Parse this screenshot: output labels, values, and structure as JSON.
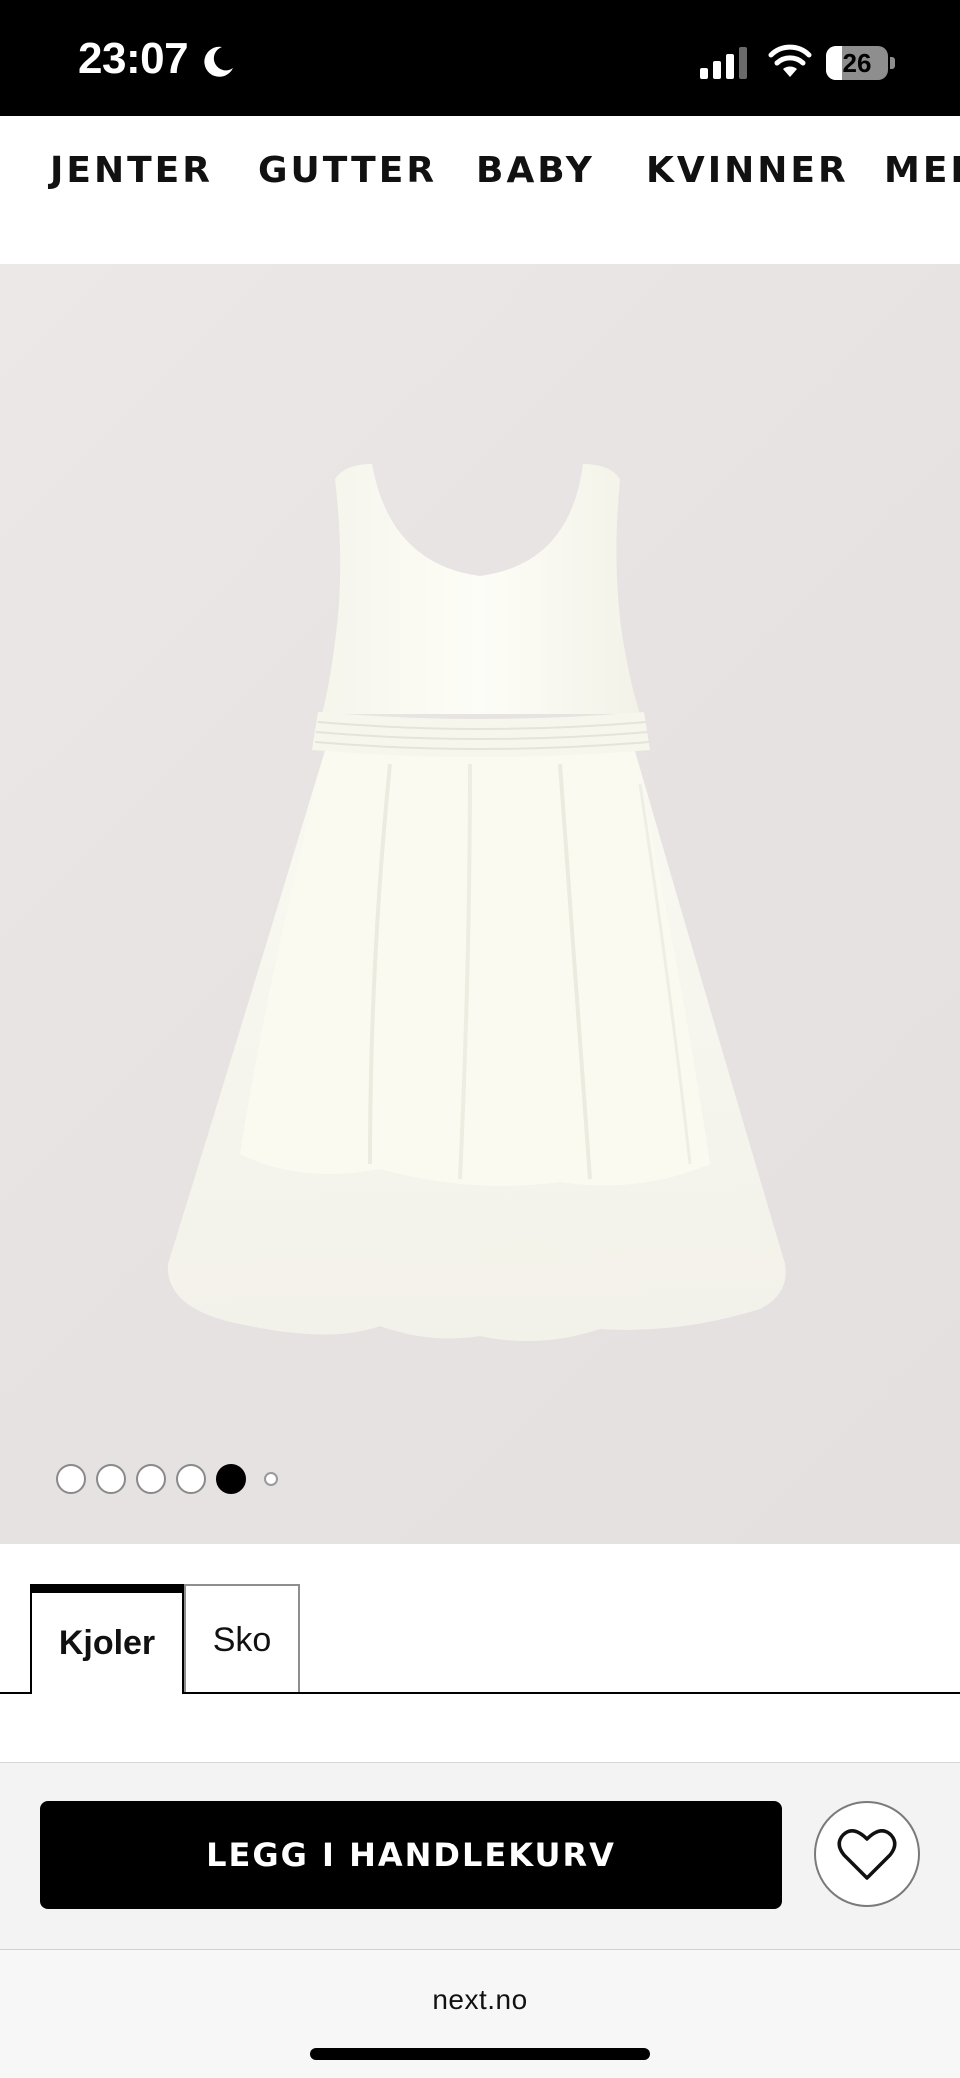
{
  "status_bar": {
    "time": "23:07",
    "battery": "26",
    "battery_level": 0.26,
    "icons": [
      "moon-icon",
      "signal-icon",
      "wifi-icon",
      "battery-icon"
    ]
  },
  "category_nav": {
    "items": [
      "JENTER",
      "GUTTER",
      "BABY",
      "KVINNER",
      "MEN"
    ]
  },
  "product_image": {
    "carousel": {
      "count": 6,
      "active_index": 4
    }
  },
  "tabs": {
    "items": [
      "Kjoler",
      "Sko"
    ],
    "active": "Kjoler"
  },
  "cart_bar": {
    "add_to_cart_label": "LEGG I HANDLEKURV",
    "wishlist_icon": "heart-icon"
  },
  "browser": {
    "url": "next.no"
  },
  "colors": {
    "status_bar_bg": "#000000",
    "button_bg": "#000000",
    "button_text": "#ffffff",
    "image_bg": "#e8e4e3",
    "dress": "#fbfaf2"
  }
}
